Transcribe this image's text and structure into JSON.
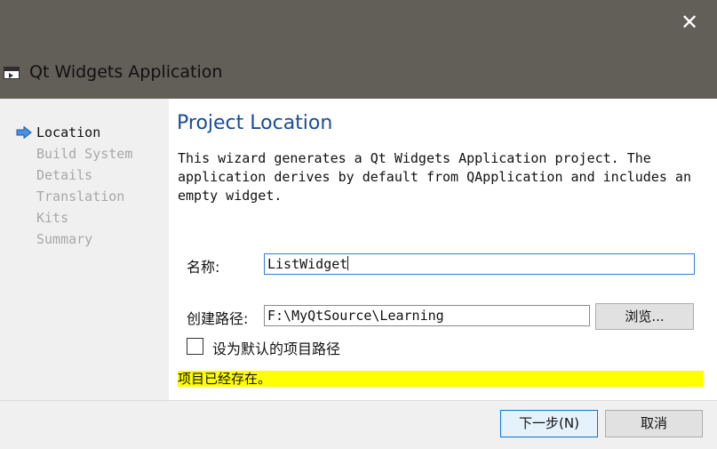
{
  "window": {
    "title": "Qt Widgets Application",
    "close_glyph": "✕"
  },
  "sidebar": {
    "steps": [
      {
        "label": "Location",
        "current": true
      },
      {
        "label": "Build System",
        "current": false
      },
      {
        "label": "Details",
        "current": false
      },
      {
        "label": "Translation",
        "current": false
      },
      {
        "label": "Kits",
        "current": false
      },
      {
        "label": "Summary",
        "current": false
      }
    ]
  },
  "main": {
    "title": "Project Location",
    "description_lines": [
      "This wizard generates a Qt Widgets Application project. The",
      "application derives by default from QApplication and includes an",
      "empty widget."
    ],
    "name_label": "名称:",
    "name_value": "ListWidget",
    "path_label": "创建路径:",
    "path_value": "F:\\MyQtSource\\Learning",
    "browse_label": "浏览...",
    "default_path_label": "设为默认的项目路径",
    "default_path_checked": false,
    "error_message": "项目已经存在。"
  },
  "footer": {
    "next_label": "下一步(N)",
    "cancel_label": "取消"
  },
  "colors": {
    "titlebar": "#625e58",
    "accent_title": "#1a4c96",
    "error_highlight": "#ffff00",
    "focus_border": "#2f7fd8"
  }
}
